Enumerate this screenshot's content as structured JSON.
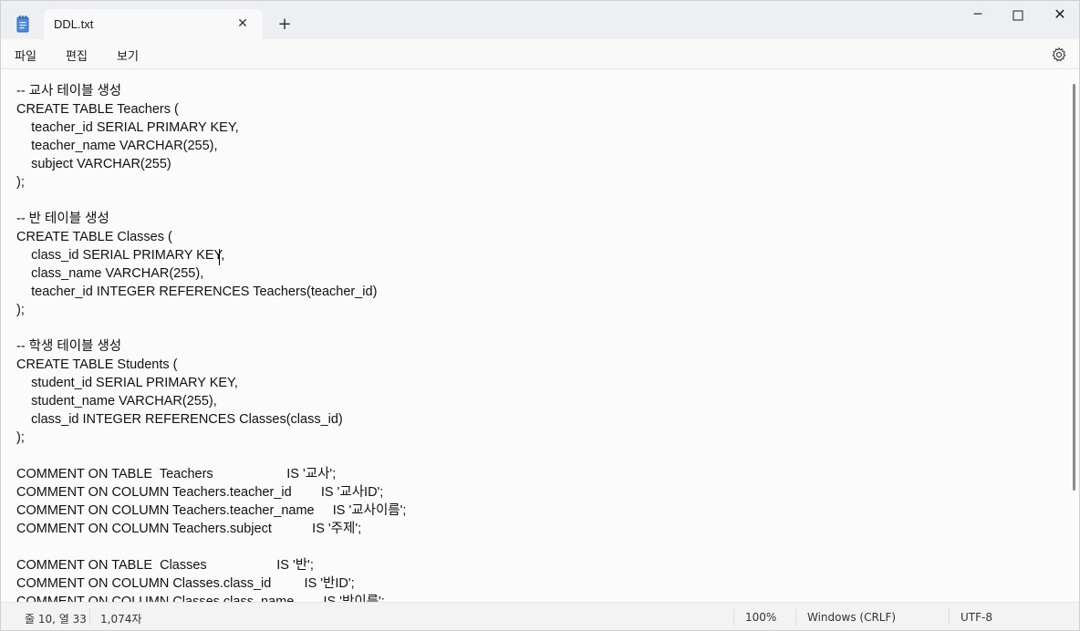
{
  "window": {
    "tab_title": "DDL.txt",
    "tab_close": "✕",
    "new_tab": "+",
    "minimize": "─",
    "maximize": "☐",
    "close": "✕"
  },
  "menu": {
    "file": "파일",
    "edit": "편집",
    "view": "보기"
  },
  "editor": {
    "lines": [
      "-- 교사 테이블 생성",
      "CREATE TABLE Teachers (",
      "    teacher_id SERIAL PRIMARY KEY,",
      "    teacher_name VARCHAR(255),",
      "    subject VARCHAR(255)",
      ");",
      "",
      "-- 반 테이블 생성",
      "CREATE TABLE Classes (",
      "    class_id SERIAL PRIMARY KEY,",
      "    class_name VARCHAR(255),",
      "    teacher_id INTEGER REFERENCES Teachers(teacher_id)",
      ");",
      "",
      "-- 학생 테이블 생성",
      "CREATE TABLE Students (",
      "    student_id SERIAL PRIMARY KEY,",
      "    student_name VARCHAR(255),",
      "    class_id INTEGER REFERENCES Classes(class_id)",
      ");",
      "",
      "COMMENT ON TABLE  Teachers                    IS '교사';",
      "COMMENT ON COLUMN Teachers.teacher_id        IS '교사ID';",
      "COMMENT ON COLUMN Teachers.teacher_name     IS '교사이름';",
      "COMMENT ON COLUMN Teachers.subject           IS '주제';",
      "",
      "COMMENT ON TABLE  Classes                   IS '반';",
      "COMMENT ON COLUMN Classes.class_id         IS '반ID';",
      "COMMENT ON COLUMN Classes.class_name        IS '반이름';"
    ]
  },
  "status": {
    "position": "줄 10, 열 33",
    "char_count": "1,074자",
    "zoom": "100%",
    "line_ending": "Windows (CRLF)",
    "encoding": "UTF-8"
  },
  "icons": {
    "app": "notepad-icon",
    "settings": "gear-icon"
  },
  "colors": {
    "titlebar": "#edeff3",
    "editor_bg": "#fbfbfb",
    "app_icon": "#2b6bc4"
  }
}
